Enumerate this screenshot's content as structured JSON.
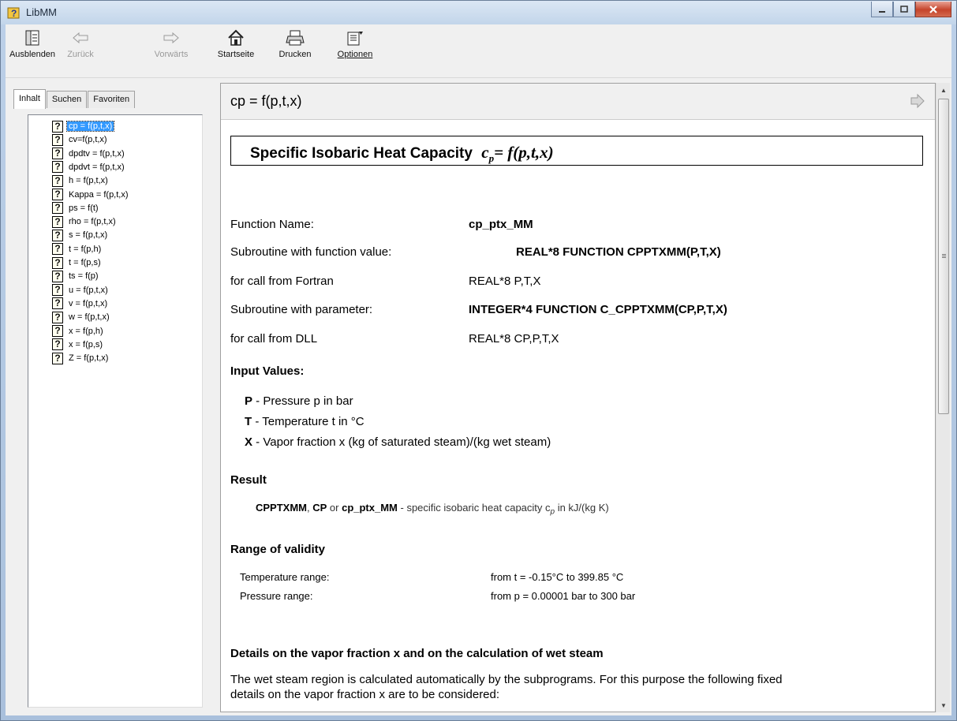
{
  "window": {
    "title": "LibMM"
  },
  "toolbar": {
    "hide": "Ausblenden",
    "back": "Zurück",
    "forward": "Vorwärts",
    "home": "Startseite",
    "print": "Drucken",
    "options": "Optionen"
  },
  "nav": {
    "tabs": [
      "Inhalt",
      "Suchen",
      "Favoriten"
    ],
    "items": [
      "cp = f(p,t,x)",
      "cv=f(p,t,x)",
      "dpdtv = f(p,t,x)",
      "dpdvt = f(p,t,x)",
      "h = f(p,t,x)",
      "Kappa = f(p,t,x)",
      "ps = f(t)",
      "rho = f(p,t,x)",
      "s = f(p,t,x)",
      "t = f(p,h)",
      "t = f(p,s)",
      "ts = f(p)",
      "u = f(p,t,x)",
      "v = f(p,t,x)",
      "w = f(p,t,x)",
      "x = f(p,h)",
      "x = f(p,s)",
      "Z = f(p,t,x)"
    ],
    "selected_index": 0
  },
  "topic": {
    "bar_title": "cp = f(p,t,x)",
    "heading": "Specific Isobaric Heat Capacity",
    "heading_formula": "= f(p,t,x)",
    "function_name_label": "Function Name:",
    "function_name_value": "cp_ptx_MM",
    "sub_value_label": "Subroutine with function value:",
    "sub_value_value": "REAL*8 FUNCTION CPPTXMM(P,T,X)",
    "fortran_label": "for call from Fortran",
    "fortran_value": "REAL*8 P,T,X",
    "sub_param_label": "Subroutine with parameter:",
    "sub_param_value": "INTEGER*4 FUNCTION C_CPPTXMM(CP,P,T,X)",
    "dll_label": "for call from DLL",
    "dll_value": "REAL*8 CP,P,T,X",
    "input_heading": "Input Values:",
    "input_p_name": "P",
    "input_p_desc": " - Pressure p in bar",
    "input_t_name": "T",
    "input_t_desc": " - Temperature t in °C",
    "input_x_name": "X",
    "input_x_desc": " - Vapor fraction x (kg of saturated steam)/(kg wet steam)",
    "result_heading": "Result",
    "result_names_1": "CPPTXMM",
    "result_sep_1": ", ",
    "result_names_2": "CP",
    "result_or": " or ",
    "result_names_3": "cp_ptx_MM",
    "result_desc": " - specific isobaric heat capacity c",
    "result_unit": " in kJ/(kg K)",
    "range_heading": "Range of validity",
    "temp_range_label": "Temperature range:",
    "temp_range_value": "from  t = -0.15°C  to  399.85 °C",
    "pressure_range_label": "Pressure range:",
    "pressure_range_value": "from  p = 0.00001 bar  to  300 bar",
    "details_heading": "Details on the vapor fraction x and on the calculation of wet steam",
    "details_line1": "The wet steam region is calculated automatically by the subprograms. For this purpose the following fixed",
    "details_line2": "details on the vapor fraction x are to be considered:"
  }
}
